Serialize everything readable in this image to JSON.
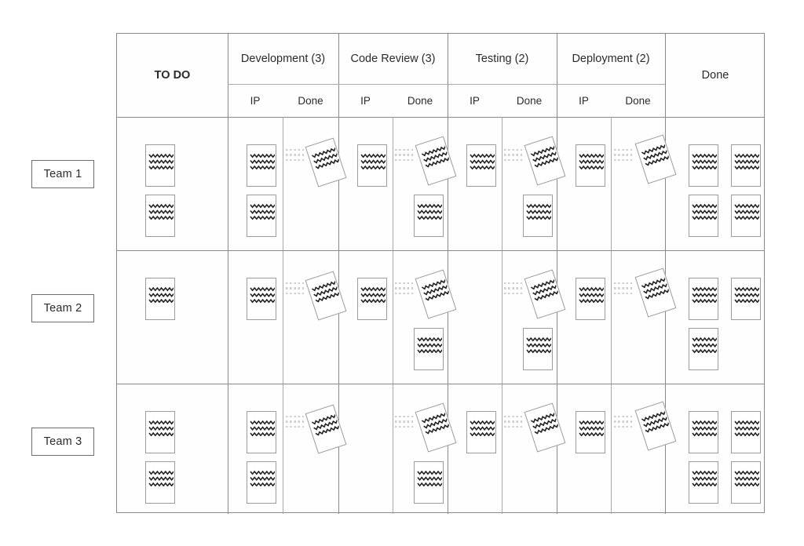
{
  "diagram": {
    "title": "Kanban board with per-stage In Progress / Done sub-columns",
    "colors": {
      "grid_line": "#a9a9a9",
      "table_border": "#8a8a8a",
      "card_border": "#9c9c9c",
      "card_fill": "#ffffff",
      "card_glyph": "#222222",
      "trace_dash": "#cfcfcf",
      "label_border": "#6e6e6e",
      "text": "#2b2b2b",
      "background": "#ffffff"
    }
  },
  "columns": [
    {
      "id": "todo",
      "label": "TO DO",
      "wip_limit": null,
      "merged_header": true,
      "sub": []
    },
    {
      "id": "dev",
      "label": "Development (3)",
      "wip_limit": 3,
      "merged_header": false,
      "sub": [
        "IP",
        "Done"
      ]
    },
    {
      "id": "codereview",
      "label": "Code Review (3)",
      "wip_limit": 3,
      "merged_header": false,
      "sub": [
        "IP",
        "Done"
      ]
    },
    {
      "id": "testing",
      "label": "Testing (2)",
      "wip_limit": 2,
      "merged_header": false,
      "sub": [
        "IP",
        "Done"
      ]
    },
    {
      "id": "deployment",
      "label": "Deployment (2)",
      "wip_limit": 2,
      "merged_header": false,
      "sub": [
        "IP",
        "Done"
      ]
    },
    {
      "id": "done",
      "label": "Done",
      "wip_limit": null,
      "merged_header": true,
      "sub": []
    }
  ],
  "sub_labels": {
    "in_progress": "IP",
    "done": "Done"
  },
  "rows": [
    {
      "id": "team-1",
      "label": "Team 1"
    },
    {
      "id": "team-2",
      "label": "Team 2"
    },
    {
      "id": "team-3",
      "label": "Team 3"
    }
  ],
  "cells": [
    {
      "row": "Team 1",
      "stages": {
        "todo": {
          "upright_cards": 2,
          "tilted_cards": 0,
          "trace": false
        },
        "dev_ip": {
          "upright_cards": 2,
          "tilted_cards": 0,
          "trace": false
        },
        "dev_done": {
          "upright_cards": 0,
          "tilted_cards": 1,
          "trace": true
        },
        "codereview_ip": {
          "upright_cards": 1,
          "tilted_cards": 0,
          "trace": false
        },
        "codereview_done": {
          "upright_cards": 1,
          "tilted_cards": 1,
          "trace": true
        },
        "testing_ip": {
          "upright_cards": 1,
          "tilted_cards": 0,
          "trace": false
        },
        "testing_done": {
          "upright_cards": 1,
          "tilted_cards": 1,
          "trace": true
        },
        "deployment_ip": {
          "upright_cards": 1,
          "tilted_cards": 0,
          "trace": false
        },
        "deployment_done": {
          "upright_cards": 0,
          "tilted_cards": 1,
          "trace": true
        },
        "done": {
          "upright_cards": 4,
          "tilted_cards": 0,
          "trace": false
        }
      }
    },
    {
      "row": "Team 2",
      "stages": {
        "todo": {
          "upright_cards": 1,
          "tilted_cards": 0,
          "trace": false
        },
        "dev_ip": {
          "upright_cards": 1,
          "tilted_cards": 0,
          "trace": false
        },
        "dev_done": {
          "upright_cards": 0,
          "tilted_cards": 1,
          "trace": true
        },
        "codereview_ip": {
          "upright_cards": 1,
          "tilted_cards": 0,
          "trace": false
        },
        "codereview_done": {
          "upright_cards": 1,
          "tilted_cards": 1,
          "trace": true
        },
        "testing_ip": {
          "upright_cards": 0,
          "tilted_cards": 0,
          "trace": false
        },
        "testing_done": {
          "upright_cards": 1,
          "tilted_cards": 1,
          "trace": true
        },
        "deployment_ip": {
          "upright_cards": 1,
          "tilted_cards": 0,
          "trace": false
        },
        "deployment_done": {
          "upright_cards": 0,
          "tilted_cards": 1,
          "trace": true
        },
        "done": {
          "upright_cards": 3,
          "tilted_cards": 0,
          "trace": false
        }
      }
    },
    {
      "row": "Team 3",
      "stages": {
        "todo": {
          "upright_cards": 2,
          "tilted_cards": 0,
          "trace": false
        },
        "dev_ip": {
          "upright_cards": 2,
          "tilted_cards": 0,
          "trace": false
        },
        "dev_done": {
          "upright_cards": 0,
          "tilted_cards": 1,
          "trace": true
        },
        "codereview_ip": {
          "upright_cards": 0,
          "tilted_cards": 0,
          "trace": false
        },
        "codereview_done": {
          "upright_cards": 1,
          "tilted_cards": 1,
          "trace": true
        },
        "testing_ip": {
          "upright_cards": 1,
          "tilted_cards": 0,
          "trace": false
        },
        "testing_done": {
          "upright_cards": 0,
          "tilted_cards": 1,
          "trace": true
        },
        "deployment_ip": {
          "upright_cards": 1,
          "tilted_cards": 0,
          "trace": false
        },
        "deployment_done": {
          "upright_cards": 0,
          "tilted_cards": 1,
          "trace": true
        },
        "done": {
          "upright_cards": 4,
          "tilted_cards": 0,
          "trace": false
        }
      }
    }
  ],
  "card_glyph": {
    "name": "zigzag-lines-icon",
    "line_count": 3,
    "meaning": "placeholder text on a work item card"
  },
  "trace_glyph": {
    "name": "dashed-trace-icon",
    "line_count": 3,
    "meaning": "ghost of a card that has moved to the next stage"
  }
}
